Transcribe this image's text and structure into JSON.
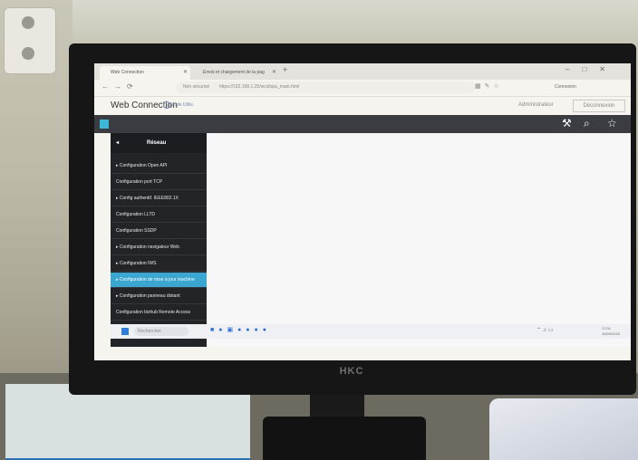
{
  "browser": {
    "tabs": [
      {
        "label": "Web Connection"
      },
      {
        "label": "Envoi et chargement de la pag"
      }
    ],
    "url_prefix": "Non sécurisé",
    "url": "https://192.168.1.25/wcd/spa_main.html",
    "connexion_label": "Connexion"
  },
  "app": {
    "title": "Web Connection",
    "mode": "Mode Utilis.",
    "user": "Administrateur",
    "logout": "Déconnexion"
  },
  "sidebar": {
    "title": "Réseau",
    "items": [
      {
        "label": "▸ Configuration Open API"
      },
      {
        "label": "Configuration port TCP"
      },
      {
        "label": "▸ Config authentif. IEEE802.1X"
      },
      {
        "label": "Configuration LLTD"
      },
      {
        "label": "Configuration SSDP"
      },
      {
        "label": "▸ Configuration navigateur Web"
      },
      {
        "label": "▸ Configuration IWS"
      },
      {
        "label": "▸ Configuration de mise à jour machine"
      },
      {
        "label": "▸ Configuration panneau distant"
      },
      {
        "label": "Configuration bizhub Remote Access"
      }
    ],
    "selected_index": 7
  },
  "taskbar": {
    "search_placeholder": "Rechercher",
    "time": "17:01",
    "date": "10/04/2024"
  },
  "monitor": {
    "brand": "HKC"
  }
}
